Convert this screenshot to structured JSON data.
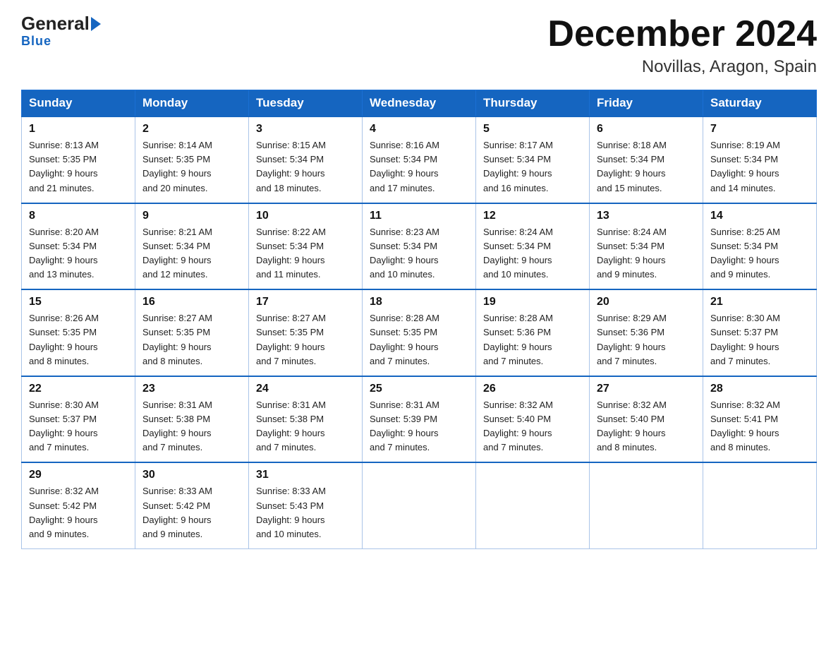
{
  "header": {
    "logo": {
      "general": "General",
      "blue": "Blue"
    },
    "title": "December 2024",
    "location": "Novillas, Aragon, Spain"
  },
  "days_of_week": [
    "Sunday",
    "Monday",
    "Tuesday",
    "Wednesday",
    "Thursday",
    "Friday",
    "Saturday"
  ],
  "weeks": [
    [
      {
        "day": "1",
        "sunrise": "8:13 AM",
        "sunset": "5:35 PM",
        "daylight": "9 hours and 21 minutes."
      },
      {
        "day": "2",
        "sunrise": "8:14 AM",
        "sunset": "5:35 PM",
        "daylight": "9 hours and 20 minutes."
      },
      {
        "day": "3",
        "sunrise": "8:15 AM",
        "sunset": "5:34 PM",
        "daylight": "9 hours and 18 minutes."
      },
      {
        "day": "4",
        "sunrise": "8:16 AM",
        "sunset": "5:34 PM",
        "daylight": "9 hours and 17 minutes."
      },
      {
        "day": "5",
        "sunrise": "8:17 AM",
        "sunset": "5:34 PM",
        "daylight": "9 hours and 16 minutes."
      },
      {
        "day": "6",
        "sunrise": "8:18 AM",
        "sunset": "5:34 PM",
        "daylight": "9 hours and 15 minutes."
      },
      {
        "day": "7",
        "sunrise": "8:19 AM",
        "sunset": "5:34 PM",
        "daylight": "9 hours and 14 minutes."
      }
    ],
    [
      {
        "day": "8",
        "sunrise": "8:20 AM",
        "sunset": "5:34 PM",
        "daylight": "9 hours and 13 minutes."
      },
      {
        "day": "9",
        "sunrise": "8:21 AM",
        "sunset": "5:34 PM",
        "daylight": "9 hours and 12 minutes."
      },
      {
        "day": "10",
        "sunrise": "8:22 AM",
        "sunset": "5:34 PM",
        "daylight": "9 hours and 11 minutes."
      },
      {
        "day": "11",
        "sunrise": "8:23 AM",
        "sunset": "5:34 PM",
        "daylight": "9 hours and 10 minutes."
      },
      {
        "day": "12",
        "sunrise": "8:24 AM",
        "sunset": "5:34 PM",
        "daylight": "9 hours and 10 minutes."
      },
      {
        "day": "13",
        "sunrise": "8:24 AM",
        "sunset": "5:34 PM",
        "daylight": "9 hours and 9 minutes."
      },
      {
        "day": "14",
        "sunrise": "8:25 AM",
        "sunset": "5:34 PM",
        "daylight": "9 hours and 9 minutes."
      }
    ],
    [
      {
        "day": "15",
        "sunrise": "8:26 AM",
        "sunset": "5:35 PM",
        "daylight": "9 hours and 8 minutes."
      },
      {
        "day": "16",
        "sunrise": "8:27 AM",
        "sunset": "5:35 PM",
        "daylight": "9 hours and 8 minutes."
      },
      {
        "day": "17",
        "sunrise": "8:27 AM",
        "sunset": "5:35 PM",
        "daylight": "9 hours and 7 minutes."
      },
      {
        "day": "18",
        "sunrise": "8:28 AM",
        "sunset": "5:35 PM",
        "daylight": "9 hours and 7 minutes."
      },
      {
        "day": "19",
        "sunrise": "8:28 AM",
        "sunset": "5:36 PM",
        "daylight": "9 hours and 7 minutes."
      },
      {
        "day": "20",
        "sunrise": "8:29 AM",
        "sunset": "5:36 PM",
        "daylight": "9 hours and 7 minutes."
      },
      {
        "day": "21",
        "sunrise": "8:30 AM",
        "sunset": "5:37 PM",
        "daylight": "9 hours and 7 minutes."
      }
    ],
    [
      {
        "day": "22",
        "sunrise": "8:30 AM",
        "sunset": "5:37 PM",
        "daylight": "9 hours and 7 minutes."
      },
      {
        "day": "23",
        "sunrise": "8:31 AM",
        "sunset": "5:38 PM",
        "daylight": "9 hours and 7 minutes."
      },
      {
        "day": "24",
        "sunrise": "8:31 AM",
        "sunset": "5:38 PM",
        "daylight": "9 hours and 7 minutes."
      },
      {
        "day": "25",
        "sunrise": "8:31 AM",
        "sunset": "5:39 PM",
        "daylight": "9 hours and 7 minutes."
      },
      {
        "day": "26",
        "sunrise": "8:32 AM",
        "sunset": "5:40 PM",
        "daylight": "9 hours and 7 minutes."
      },
      {
        "day": "27",
        "sunrise": "8:32 AM",
        "sunset": "5:40 PM",
        "daylight": "9 hours and 8 minutes."
      },
      {
        "day": "28",
        "sunrise": "8:32 AM",
        "sunset": "5:41 PM",
        "daylight": "9 hours and 8 minutes."
      }
    ],
    [
      {
        "day": "29",
        "sunrise": "8:32 AM",
        "sunset": "5:42 PM",
        "daylight": "9 hours and 9 minutes."
      },
      {
        "day": "30",
        "sunrise": "8:33 AM",
        "sunset": "5:42 PM",
        "daylight": "9 hours and 9 minutes."
      },
      {
        "day": "31",
        "sunrise": "8:33 AM",
        "sunset": "5:43 PM",
        "daylight": "9 hours and 10 minutes."
      },
      null,
      null,
      null,
      null
    ]
  ],
  "labels": {
    "sunrise": "Sunrise:",
    "sunset": "Sunset:",
    "daylight": "Daylight:"
  }
}
